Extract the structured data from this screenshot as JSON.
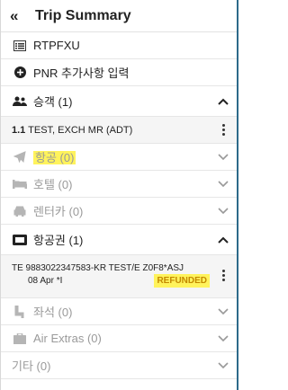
{
  "header": {
    "collapse_glyph": "«",
    "title": "Trip Summary"
  },
  "record_locator": {
    "icon": "list-icon",
    "text": "RTPFXU"
  },
  "add_pnr": {
    "icon": "plus-circle-icon",
    "text": "PNR 추가사항 입력"
  },
  "passengers": {
    "icon": "users-icon",
    "label": "승객 (1)",
    "expanded": true
  },
  "passenger_item": {
    "index": "1.1",
    "name": "TEST, EXCH MR (ADT)"
  },
  "sections": [
    {
      "name": "air",
      "icon": "plane-icon",
      "label": "항공 (0)"
    },
    {
      "name": "hotel",
      "icon": "bed-icon",
      "label": "호텔 (0)"
    },
    {
      "name": "car",
      "icon": "car-icon",
      "label": "렌터카 (0)"
    }
  ],
  "tickets": {
    "icon": "ticket-icon",
    "label": "항공권 (1)",
    "expanded": true
  },
  "ticket_item": {
    "line1": "TE 9883022347583-KR TEST/E Z0F8*ASJ",
    "line2": "08 Apr *I",
    "status": "REFUNDED"
  },
  "sections_bottom": [
    {
      "name": "seats",
      "icon": "seat-icon",
      "label": "좌석 (0)"
    },
    {
      "name": "air-extras",
      "icon": "briefcase-icon",
      "label": "Air Extras (0)"
    },
    {
      "name": "other",
      "icon": "",
      "label": "기타 (0)"
    }
  ],
  "colors": {
    "highlight": "#fff35c",
    "badge_text": "#c48a00",
    "accent_border": "#2d6a8a"
  }
}
